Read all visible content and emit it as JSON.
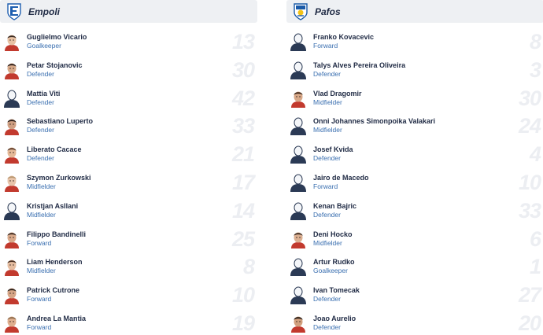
{
  "teams": [
    {
      "name": "Empoli",
      "crest_icon": "empoli-crest-icon",
      "players": [
        {
          "name": "Guglielmo Vicario",
          "position": "Goalkeeper",
          "number": "13",
          "avatar": "photo",
          "skin": "#e8c2a4",
          "hair": "#3a2a22"
        },
        {
          "name": "Petar Stojanovic",
          "position": "Defender",
          "number": "30",
          "avatar": "photo",
          "skin": "#d8a988",
          "hair": "#2a1d18"
        },
        {
          "name": "Mattia Viti",
          "position": "Defender",
          "number": "42",
          "avatar": "silhouette"
        },
        {
          "name": "Sebastiano Luperto",
          "position": "Defender",
          "number": "33",
          "avatar": "photo",
          "skin": "#cf9f82",
          "hair": "#2b1f1a"
        },
        {
          "name": "Liberato Cacace",
          "position": "Defender",
          "number": "21",
          "avatar": "photo",
          "skin": "#e5b998",
          "hair": "#5a3a28"
        },
        {
          "name": "Szymon Zurkowski",
          "position": "Midfielder",
          "number": "17",
          "avatar": "photo",
          "skin": "#e8c4aa",
          "hair": "#b89870"
        },
        {
          "name": "Kristjan Asllani",
          "position": "Midfielder",
          "number": "14",
          "avatar": "silhouette"
        },
        {
          "name": "Filippo Bandinelli",
          "position": "Forward",
          "number": "25",
          "avatar": "photo",
          "skin": "#d9a98a",
          "hair": "#3d2a20"
        },
        {
          "name": "Liam Henderson",
          "position": "Midfielder",
          "number": "8",
          "avatar": "photo",
          "skin": "#e6bda0",
          "hair": "#4a3022"
        },
        {
          "name": "Patrick Cutrone",
          "position": "Forward",
          "number": "10",
          "avatar": "photo",
          "skin": "#d6a586",
          "hair": "#2a1e18"
        },
        {
          "name": "Andrea La Mantia",
          "position": "Forward",
          "number": "19",
          "avatar": "photo",
          "skin": "#dfae8e",
          "hair": "#8a6a4a"
        }
      ]
    },
    {
      "name": "Pafos",
      "crest_icon": "pafos-crest-icon",
      "players": [
        {
          "name": "Franko Kovacevic",
          "position": "Forward",
          "number": "8",
          "avatar": "silhouette"
        },
        {
          "name": "Talys Alves Pereira Oliveira",
          "position": "Defender",
          "number": "3",
          "avatar": "silhouette"
        },
        {
          "name": "Vlad Dragomir",
          "position": "Midfielder",
          "number": "30",
          "avatar": "photo",
          "skin": "#d8a888",
          "hair": "#3a2418"
        },
        {
          "name": "Onni Johannes Simonpoika Valakari",
          "position": "Midfielder",
          "number": "24",
          "avatar": "silhouette"
        },
        {
          "name": "Josef Kvida",
          "position": "Defender",
          "number": "4",
          "avatar": "silhouette"
        },
        {
          "name": "Jairo de Macedo",
          "position": "Forward",
          "number": "10",
          "avatar": "silhouette"
        },
        {
          "name": "Kenan Bajric",
          "position": "Defender",
          "number": "33",
          "avatar": "silhouette"
        },
        {
          "name": "Deni Hocko",
          "position": "Midfielder",
          "number": "6",
          "avatar": "photo",
          "skin": "#dcb092",
          "hair": "#3a2a20"
        },
        {
          "name": "Artur Rudko",
          "position": "Goalkeeper",
          "number": "1",
          "avatar": "silhouette"
        },
        {
          "name": "Ivan Tomecak",
          "position": "Defender",
          "number": "27",
          "avatar": "silhouette"
        },
        {
          "name": "Joao Aurelio",
          "position": "Defender",
          "number": "20",
          "avatar": "photo",
          "skin": "#d2a07e",
          "hair": "#1e1612"
        }
      ]
    }
  ],
  "colors": {
    "header_bg": "#eef0f3",
    "name_text": "#1f2a44",
    "position_text": "#3a6fb0",
    "number_text": "#eceef2",
    "empoli_blue": "#1f5fb0",
    "pafos_blue": "#1a5aa8",
    "pafos_yellow": "#f2c318",
    "silhouette": "#2b3a55"
  }
}
